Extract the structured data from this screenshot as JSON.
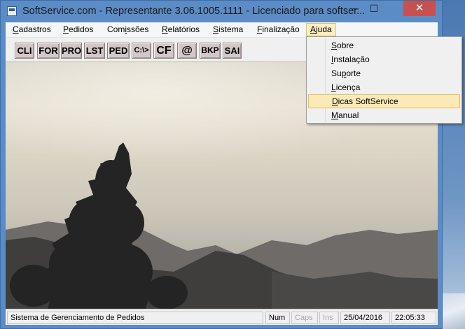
{
  "window": {
    "title": "SoftService.com - Representante 3.06.1005.1111 - Licenciado para softser...",
    "min_glyph": "─",
    "max_glyph": "☐",
    "close_glyph": "✕"
  },
  "menu": {
    "items": [
      {
        "acc": "C",
        "rest": "adastros"
      },
      {
        "acc": "P",
        "rest": "edidos"
      },
      {
        "pre": "Com",
        "acc": "i",
        "rest": "ssões"
      },
      {
        "acc": "R",
        "rest": "elatórios"
      },
      {
        "acc": "S",
        "rest": "istema"
      },
      {
        "acc": "F",
        "rest": "inalização"
      },
      {
        "acc": "A",
        "rest": "juda"
      }
    ]
  },
  "toolbar": {
    "buttons": [
      "CLI",
      "FOR",
      "PRO",
      "LST",
      "PED",
      "C:\\>",
      "CF",
      "@",
      "BKP",
      "SAI"
    ]
  },
  "dropdown": {
    "items": [
      {
        "acc": "S",
        "rest": "obre"
      },
      {
        "acc": "I",
        "rest": "nstalação"
      },
      {
        "pre": "Su",
        "acc": "p",
        "rest": "orte"
      },
      {
        "acc": "L",
        "rest": "icença"
      },
      {
        "acc": "D",
        "rest": "icas SoftService"
      },
      {
        "acc": "M",
        "rest": "anual"
      }
    ],
    "highlighted_index": 4
  },
  "status": {
    "message": "Sistema de Gerenciamento de Pedidos",
    "num": "Num",
    "caps": "Caps",
    "ins": "Ins",
    "date": "25/04/2016",
    "time": "22:05:33"
  },
  "icons": [
    "app-icon",
    "minimize-icon",
    "maximize-icon",
    "close-icon"
  ]
}
